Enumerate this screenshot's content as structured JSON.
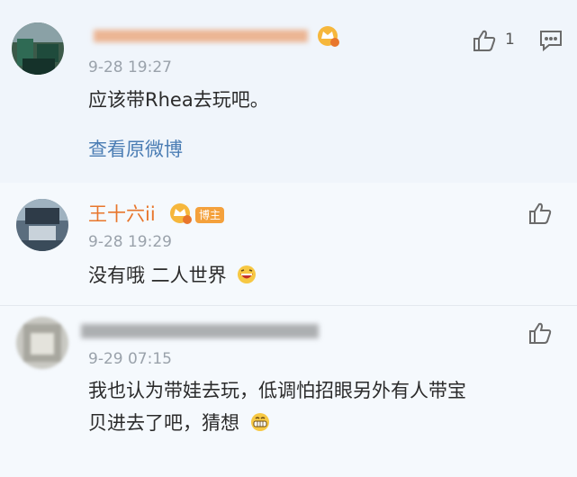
{
  "comments": [
    {
      "time": "9-28 19:27",
      "text": "应该带Rhea去玩吧。",
      "view_original": "查看原微博",
      "like_count": "1"
    },
    {
      "name": "王十六ii",
      "badge": "博主",
      "time": "9-28 19:29",
      "text": "没有哦 二人世界"
    },
    {
      "time": "9-29 07:15",
      "text_line1": "我也认为带娃去玩，低调怕招眼另外有人带宝",
      "text_line2": "贝进去了吧，猜想"
    }
  ],
  "colors": {
    "username": "#e8762c",
    "link": "#4b7db4",
    "badge": "#f4a13c"
  }
}
